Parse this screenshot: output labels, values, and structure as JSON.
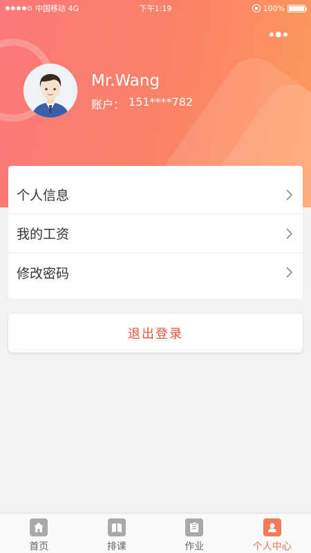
{
  "status_bar": {
    "carrier": "中国移动 4G",
    "time": "下午1:19",
    "battery": "100%"
  },
  "profile": {
    "name": "Mr.Wang",
    "account_label": "账户：",
    "account_number": "151****782"
  },
  "menu": {
    "items": [
      {
        "label": "个人信息"
      },
      {
        "label": "我的工资"
      },
      {
        "label": "修改密码"
      }
    ]
  },
  "logout_label": "退出登录",
  "tabbar": {
    "tabs": [
      {
        "label": "首页",
        "icon": "home-icon",
        "active": false
      },
      {
        "label": "排课",
        "icon": "book-icon",
        "active": false
      },
      {
        "label": "作业",
        "icon": "clipboard-icon",
        "active": false
      },
      {
        "label": "个人中心",
        "icon": "person-icon",
        "active": true
      }
    ]
  },
  "colors": {
    "header_gradient_start": "#f9787a",
    "header_gradient_end": "#fd9a5c",
    "accent": "#f0704f",
    "logout_text": "#e5533a"
  }
}
